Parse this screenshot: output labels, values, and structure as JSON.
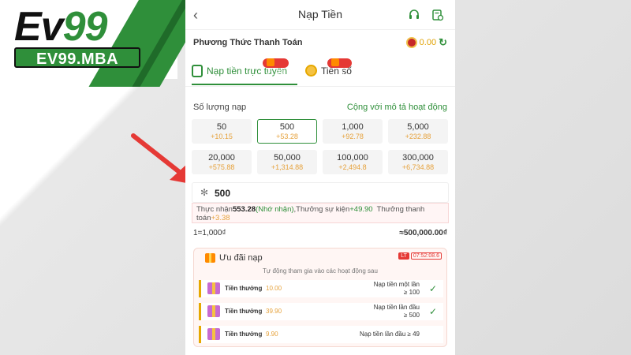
{
  "brand": {
    "logo_part1": "Ev",
    "logo_part2": "99",
    "site": "EV99.MBA"
  },
  "header": {
    "title": "Nạp Tiền"
  },
  "payment": {
    "label": "Phương Thức Thanh Toán",
    "balance": "0.00"
  },
  "tabs": [
    {
      "label": "Nạp tiền trực tuyến",
      "promo": "+1.8%"
    },
    {
      "label": "Tiền số",
      "promo": "+1%"
    }
  ],
  "amount": {
    "label": "Số lượng nạp",
    "link": "Cộng với mô tả hoạt động",
    "options": [
      {
        "value": "50",
        "bonus": "+10.15"
      },
      {
        "value": "500",
        "bonus": "+53.28"
      },
      {
        "value": "1,000",
        "bonus": "+92.78"
      },
      {
        "value": "5,000",
        "bonus": "+232.88"
      },
      {
        "value": "20,000",
        "bonus": "+575.88"
      },
      {
        "value": "50,000",
        "bonus": "+1,314.88"
      },
      {
        "value": "100,000",
        "bonus": "+2,494.8"
      },
      {
        "value": "300,000",
        "bonus": "+6,734.88"
      }
    ],
    "input_value": "500"
  },
  "receive": {
    "prefix": "Thực nhận",
    "amount": "553.28",
    "note": "(Nhớ nhận)",
    "event_label": ",Thưởng sự kiện",
    "event_bonus": "+49.90",
    "pay_label": "Thưởng thanh toán",
    "pay_bonus": "+3.38"
  },
  "rate": {
    "left": "1=1,000₫",
    "right": "≈500,000.00₫"
  },
  "offers": {
    "title": "Ưu đãi nạp",
    "badge": "LT",
    "timer": "07:52:08.6",
    "subtitle": "Tự động tham gia vào các hoạt động sau",
    "items": [
      {
        "label": "Tiền thưởng",
        "amount": "10.00",
        "cond1": "Nạp tiền một lần",
        "cond2": "≥ 100"
      },
      {
        "label": "Tiền thưởng",
        "amount": "39.90",
        "cond1": "Nạp tiền lần đầu",
        "cond2": "≥ 500"
      },
      {
        "label": "Tiền thưởng",
        "amount": "9.90",
        "cond1": "Nạp tiền lần đầu ≥ 49"
      }
    ]
  },
  "colors": {
    "accent": "#2f8f3a",
    "bonus": "#e6a23c",
    "alert": "#e53935"
  },
  "icons": {
    "back": "chevron-left-icon",
    "support": "headset-icon",
    "history": "record-icon",
    "check": "check-icon"
  }
}
